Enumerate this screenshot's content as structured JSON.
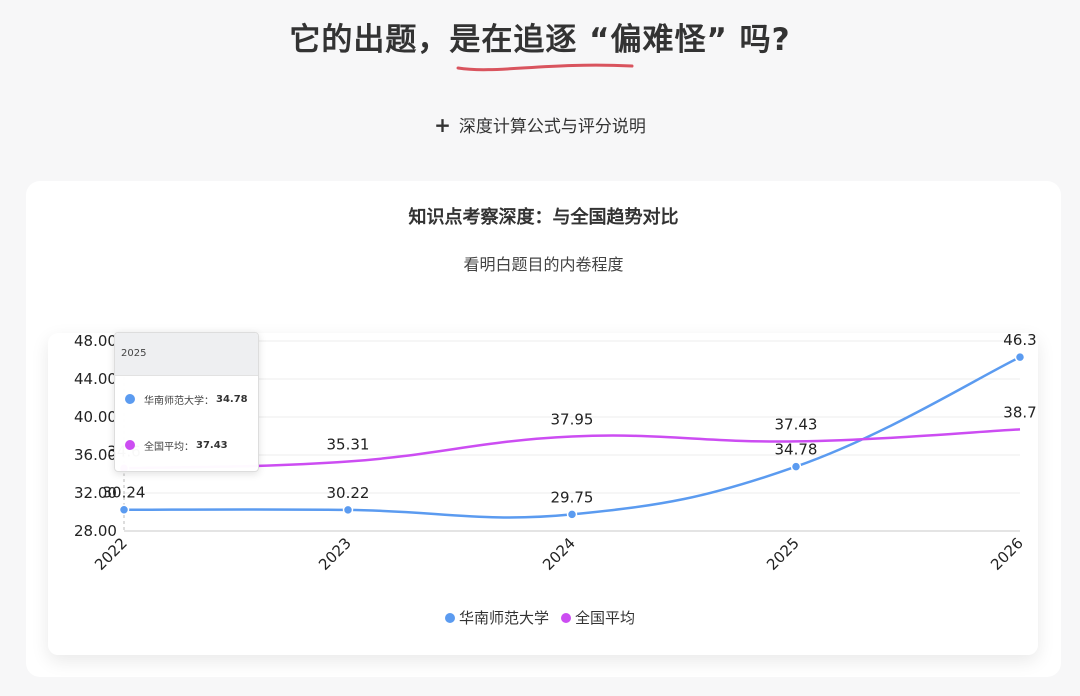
{
  "header": {
    "headline": "它的出题，是在追逐 “偏难怪” 吗?",
    "accent_color": "#d9545e"
  },
  "formula_toggle": {
    "icon": "plus-icon",
    "label": "深度计算公式与评分说明"
  },
  "card": {
    "title": "知识点考察深度：与全国趋势对比",
    "subtitle": "看明白题目的内卷程度"
  },
  "tooltip": {
    "year": "2025",
    "rows": [
      {
        "label": "华南师范大学：",
        "value": "34.78",
        "color": "#5b9bf0"
      },
      {
        "label": "全国平均：",
        "value": "37.43",
        "color": "#cc4df2"
      }
    ]
  },
  "chart_data": {
    "type": "line",
    "categories": [
      "2022",
      "2023",
      "2024",
      "2025",
      "2026"
    ],
    "series": [
      {
        "name": "华南师范大学",
        "color": "#5b9bf0",
        "values": [
          30.24,
          30.22,
          29.75,
          34.78,
          46.3
        ],
        "labels": [
          "30.24",
          "30.22",
          "29.75",
          "34.78",
          "46.3"
        ]
      },
      {
        "name": "全国平均",
        "color": "#cc4df2",
        "values": [
          34.6,
          35.31,
          37.95,
          37.43,
          38.7
        ],
        "labels": [
          "34.6",
          "35.31",
          "37.95",
          "37.43",
          "38.7"
        ]
      }
    ],
    "yticks": [
      "28.00",
      "32.00",
      "36.00",
      "40.00",
      "44.00",
      "48.00"
    ],
    "ylim": [
      28,
      48
    ],
    "grid": true,
    "legend_position": "bottom"
  }
}
